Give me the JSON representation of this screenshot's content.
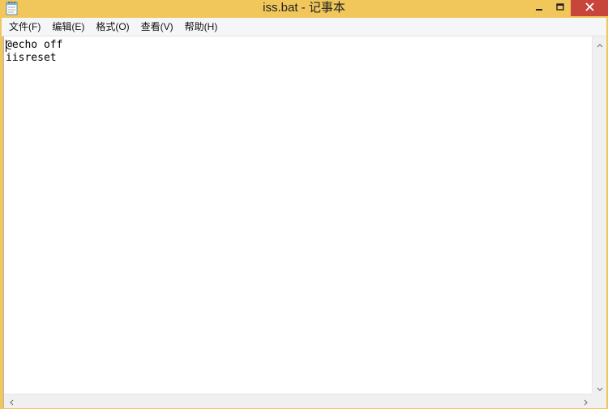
{
  "window": {
    "title": "iss.bat - 记事本",
    "icon": "notepad-icon",
    "controls": {
      "minimize": "minimize-icon",
      "maximize": "maximize-icon",
      "close": "close-icon"
    },
    "accent": "#f1c75c",
    "close_color": "#c7453a"
  },
  "menu": {
    "items": [
      {
        "label": "文件(F)"
      },
      {
        "label": "编辑(E)"
      },
      {
        "label": "格式(O)"
      },
      {
        "label": "查看(V)"
      },
      {
        "label": "帮助(H)"
      }
    ]
  },
  "editor": {
    "lines": [
      "@echo off",
      "iisreset"
    ]
  }
}
